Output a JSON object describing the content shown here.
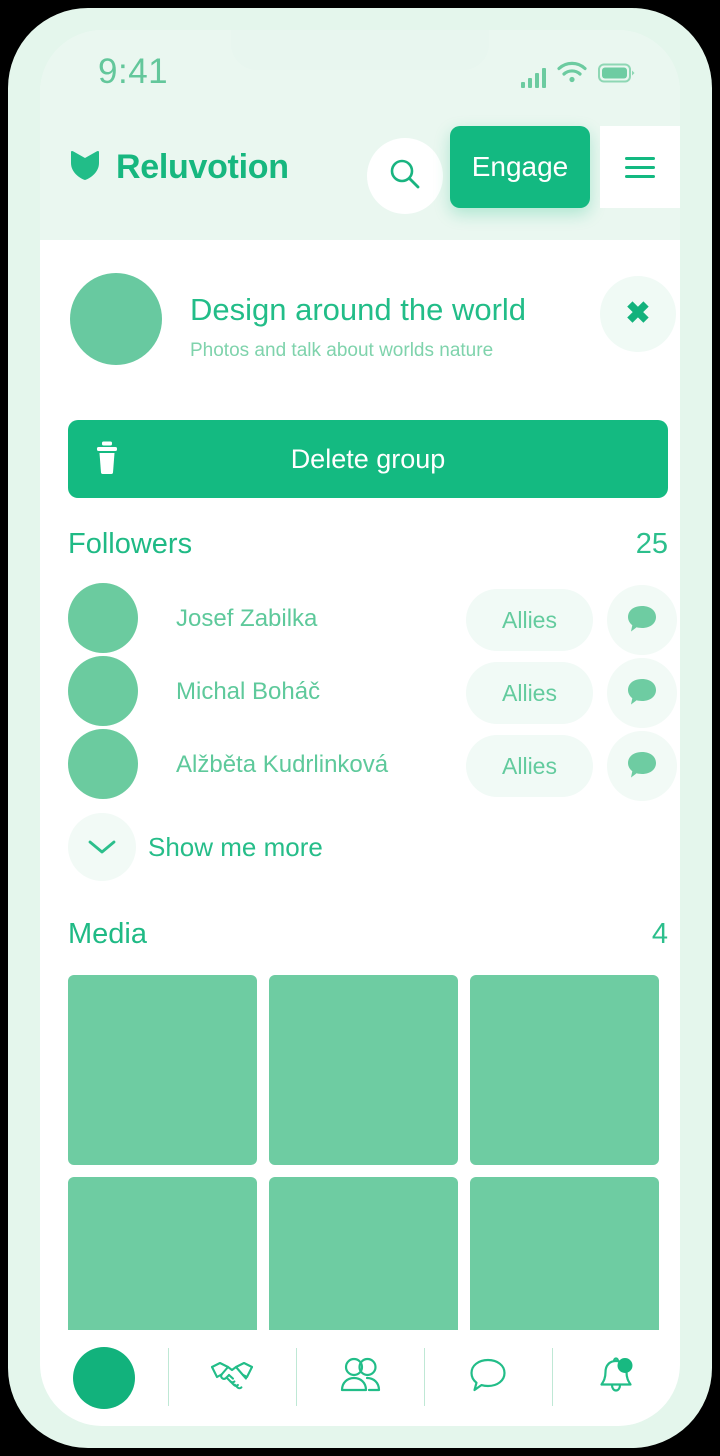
{
  "status_bar": {
    "time": "9:41",
    "icons": [
      "signal-bars-icon",
      "wifi-icon",
      "battery-icon"
    ]
  },
  "header": {
    "brand_name": "Reluvotion",
    "logo_icon": "heart-icon",
    "search_icon": "search-icon",
    "engage_label": "Engage",
    "menu_icon": "hamburger-menu-icon"
  },
  "group": {
    "avatar_icon": "group-avatar",
    "title": "Design around the world",
    "subtitle": "Photos and talk about worlds nature",
    "close_icon": "close-icon",
    "close_label": "✖"
  },
  "delete_group": {
    "label": "Delete group",
    "icon": "trash-icon"
  },
  "followers": {
    "title": "Followers",
    "count": "25",
    "items": [
      {
        "name": "Josef Zabilka",
        "relation": "Allies",
        "message_icon": "chat-bubble-icon"
      },
      {
        "name": "Michal Boháč",
        "relation": "Allies",
        "message_icon": "chat-bubble-icon"
      },
      {
        "name": "Alžběta Kudrlinková",
        "relation": "Allies",
        "message_icon": "chat-bubble-icon"
      }
    ],
    "show_more_label": "Show me more",
    "show_more_icon": "chevron-down-icon"
  },
  "media": {
    "title": "Media",
    "count": "4",
    "tiles": [
      "media-thumbnail-1",
      "media-thumbnail-2",
      "media-thumbnail-3",
      "media-thumbnail-4",
      "media-thumbnail-5",
      "media-thumbnail-6"
    ]
  },
  "bottom_nav": {
    "items": [
      {
        "name": "profile-avatar",
        "icon": "avatar-icon",
        "active": true
      },
      {
        "name": "handshake",
        "icon": "handshake-icon",
        "active": false
      },
      {
        "name": "groups",
        "icon": "people-icon",
        "active": false
      },
      {
        "name": "messages",
        "icon": "chat-bubble-icon",
        "active": false
      },
      {
        "name": "notifications",
        "icon": "bell-icon",
        "active": false,
        "badge": true
      }
    ]
  },
  "colors": {
    "brand_green": "#13b981",
    "accent_green": "#6ecca2",
    "muted_green": "#63cb9e",
    "pale_mint": "#f1faf6",
    "screen_bg": "#eaf7f0",
    "frame_bg": "#e4f6ec",
    "sheet_white": "#ffffff"
  }
}
